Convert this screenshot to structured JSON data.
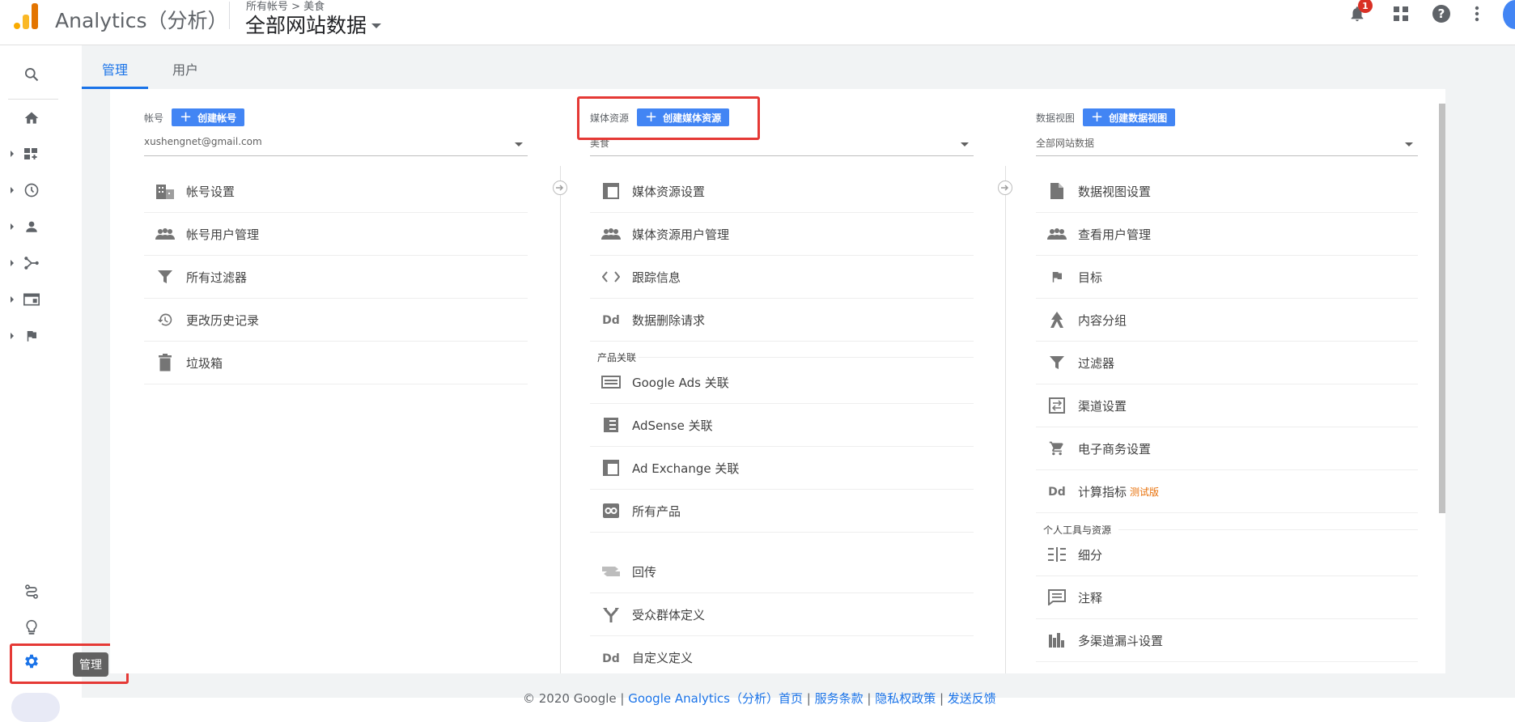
{
  "header": {
    "app_title": "Analytics（分析）",
    "breadcrumb": "所有帐号 > 美食",
    "view_name": "全部网站数据",
    "notification_count": "1"
  },
  "tabs": [
    {
      "label": "管理",
      "active": true
    },
    {
      "label": "用户",
      "active": false
    }
  ],
  "sidenav": {
    "icons": [
      "search-icon",
      "home-icon",
      "customization-icon",
      "realtime-icon",
      "audience-icon",
      "acquisition-icon",
      "behavior-icon",
      "conversions-icon",
      "attribution-icon",
      "discover-icon",
      "admin-gear-icon"
    ],
    "tooltip": "管理"
  },
  "account": {
    "label": "帐号",
    "create_button": "创建帐号",
    "selected": "xushengnet@gmail.com",
    "items": [
      "帐号设置",
      "帐号用户管理",
      "所有过滤器",
      "更改历史记录",
      "垃圾箱"
    ]
  },
  "property": {
    "label": "媒体资源",
    "create_button": "创建媒体资源",
    "selected": "美食",
    "items": [
      "媒体资源设置",
      "媒体资源用户管理",
      "跟踪信息",
      "数据删除请求"
    ],
    "section_product": "产品关联",
    "product_items": [
      "Google Ads 关联",
      "AdSense 关联",
      "Ad Exchange 关联",
      "所有产品"
    ],
    "more_items": [
      "回传",
      "受众群体定义",
      "自定义定义"
    ]
  },
  "view": {
    "label": "数据视图",
    "create_button": "创建数据视图",
    "selected": "全部网站数据",
    "items": [
      "数据视图设置",
      "查看用户管理",
      "目标",
      "内容分组",
      "过滤器",
      "渠道设置",
      "电子商务设置",
      "计算指标"
    ],
    "beta_label": "测试版",
    "section_personal": "个人工具与资源",
    "personal_items": [
      "细分",
      "注释",
      "多渠道漏斗设置"
    ]
  },
  "footer": {
    "copyright": "© 2020 Google | ",
    "links": [
      "Google Analytics（分析）首页",
      "服务条款",
      "隐私权政策",
      "发送反馈"
    ],
    "sep": " | "
  },
  "colors": {
    "accent": "#1a73e8",
    "button": "#4285f4",
    "highlight": "#e53935",
    "logo": "#f9ab00"
  }
}
